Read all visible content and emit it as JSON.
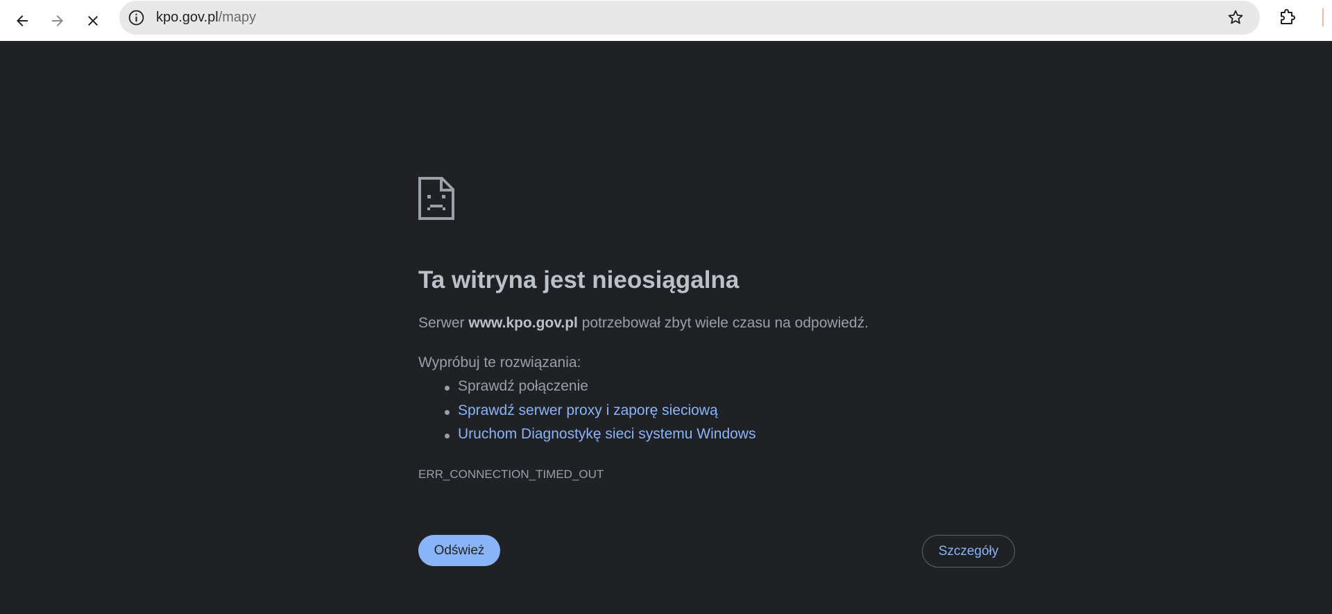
{
  "browser": {
    "url_host": "kpo.gov.pl",
    "url_path": "/mapy",
    "icons": {
      "back": "arrow-left-icon",
      "forward": "arrow-right-icon",
      "stop": "close-icon",
      "site_info": "info-icon",
      "bookmark": "star-icon",
      "extensions": "puzzle-icon"
    }
  },
  "error_page": {
    "title": "Ta witryna jest nieosiągalna",
    "desc_prefix": "Serwer ",
    "desc_host": "www.kpo.gov.pl",
    "desc_suffix": " potrzebował zbyt wiele czasu na odpowiedź.",
    "try_label": "Wypróbuj te rozwiązania:",
    "suggestions": [
      "Sprawdź połączenie",
      "Sprawdź serwer proxy i zaporę sieciową",
      "Uruchom Diagnostykę sieci systemu Windows"
    ],
    "error_code": "ERR_CONNECTION_TIMED_OUT",
    "reload_label": "Odśwież",
    "details_label": "Szczegóły"
  },
  "colors": {
    "page_bg": "#202124",
    "title": "#bdc1c6",
    "body_text": "#9aa0a6",
    "link": "#8ab4f8",
    "primary_button": "#8ab4f8",
    "toolbar_bg": "#ffffff",
    "omnibox_bg": "#e8e8e8"
  }
}
